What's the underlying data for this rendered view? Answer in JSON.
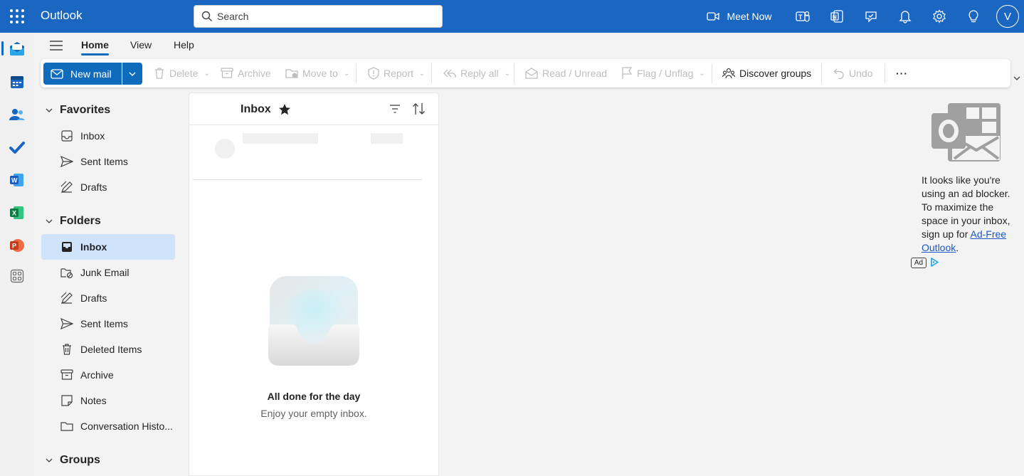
{
  "header": {
    "app_name": "Outlook",
    "search_placeholder": "Search",
    "meet_now_label": "Meet Now",
    "avatar_initial": "V",
    "icons": [
      "app-launcher-icon",
      "search-icon",
      "video-camera-icon",
      "teams-icon",
      "onenote-icon",
      "todo-icon",
      "bell-icon",
      "gear-icon",
      "lightbulb-icon"
    ]
  },
  "tabs": [
    {
      "label": "Home",
      "active": true
    },
    {
      "label": "View",
      "active": false
    },
    {
      "label": "Help",
      "active": false
    }
  ],
  "ribbon": {
    "new_mail": "New mail",
    "delete": "Delete",
    "archive": "Archive",
    "move_to": "Move to",
    "report": "Report",
    "reply_all": "Reply all",
    "read_unread": "Read / Unread",
    "flag_unflag": "Flag / Unflag",
    "discover_groups": "Discover groups",
    "undo": "Undo",
    "more": "···"
  },
  "rail": {
    "apps": [
      "mail",
      "calendar",
      "people",
      "to-do",
      "word",
      "excel",
      "powerpoint",
      "more-apps"
    ]
  },
  "folders": {
    "favorites_header": "Favorites",
    "favorites": [
      {
        "label": "Inbox",
        "icon": "inbox-icon"
      },
      {
        "label": "Sent Items",
        "icon": "send-icon"
      },
      {
        "label": "Drafts",
        "icon": "drafts-icon"
      }
    ],
    "folders_header": "Folders",
    "items": [
      {
        "label": "Inbox",
        "icon": "inbox-icon",
        "selected": true
      },
      {
        "label": "Junk Email",
        "icon": "junk-icon"
      },
      {
        "label": "Drafts",
        "icon": "drafts-icon"
      },
      {
        "label": "Sent Items",
        "icon": "send-icon"
      },
      {
        "label": "Deleted Items",
        "icon": "trash-icon"
      },
      {
        "label": "Archive",
        "icon": "archive-icon"
      },
      {
        "label": "Notes",
        "icon": "note-icon"
      },
      {
        "label": "Conversation Histo...",
        "icon": "folder-icon"
      }
    ],
    "groups_header": "Groups"
  },
  "message_list": {
    "title": "Inbox",
    "empty_title": "All done for the day",
    "empty_subtitle": "Enjoy your empty inbox."
  },
  "ad": {
    "text_before_link": "It looks like you're using an ad blocker. To maximize the space in your inbox, sign up for ",
    "link_text": "Ad-Free Outlook",
    "text_after_link": ".",
    "badge": "Ad"
  },
  "colors": {
    "header_blue": "#1a66c1",
    "accent": "#0f6cbd",
    "selected_folder": "#cfe4fa"
  }
}
